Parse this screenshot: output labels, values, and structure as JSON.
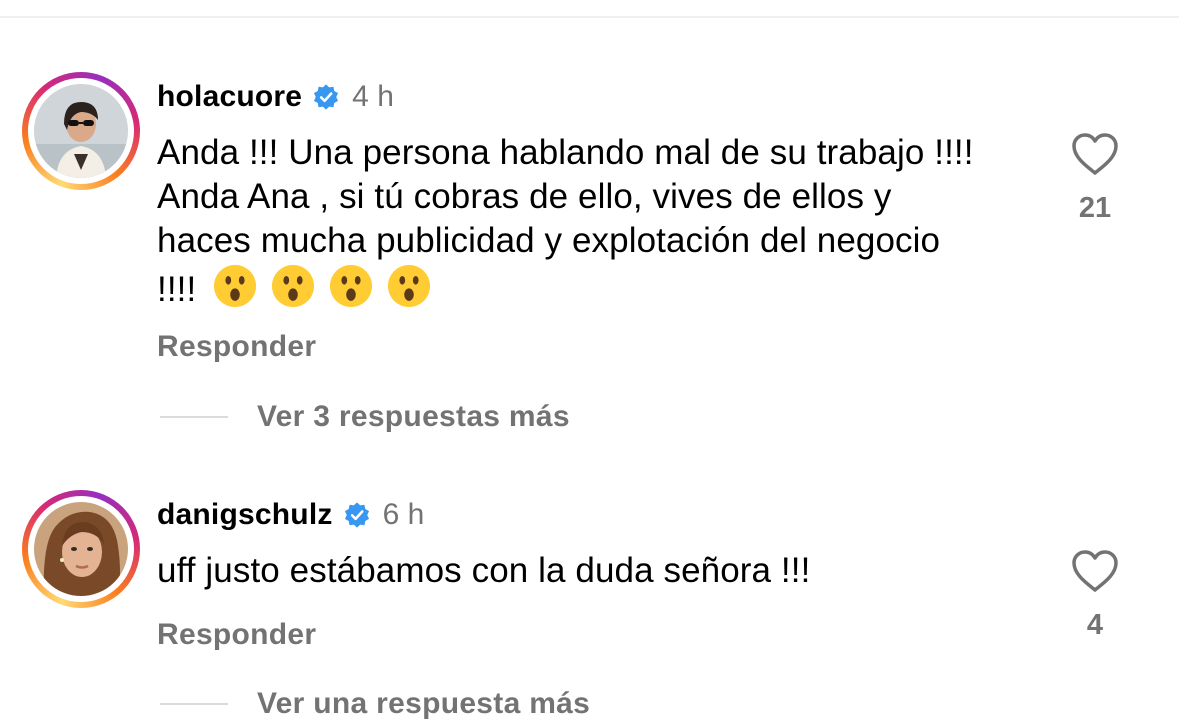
{
  "comments": [
    {
      "username": "holacuore",
      "verified": true,
      "time": "4 h",
      "text": "Anda !!! Una persona hablando mal de su trabajo !!!! Anda Ana , si tú cobras de ello, vives de ellos y haces mucha publicidad y explotación del negocio !!!!",
      "emojis": [
        "😮",
        "😮",
        "😮",
        "😮"
      ],
      "reply_label": "Responder",
      "likes": "21",
      "view_replies": "Ver 3 respuestas más",
      "avatar_icon": "profile-photo-woman-sunglasses"
    },
    {
      "username": "danigschulz",
      "verified": true,
      "time": "6 h",
      "text": "uff justo estábamos con la duda señora !!!",
      "emojis": [],
      "reply_label": "Responder",
      "likes": "4",
      "view_replies": "Ver una respuesta más",
      "avatar_icon": "profile-photo-woman-portrait"
    }
  ],
  "colors": {
    "text": "#000000",
    "secondary": "#737373",
    "verified_blue": "#3897f0",
    "divider": "#dbdbdb"
  }
}
